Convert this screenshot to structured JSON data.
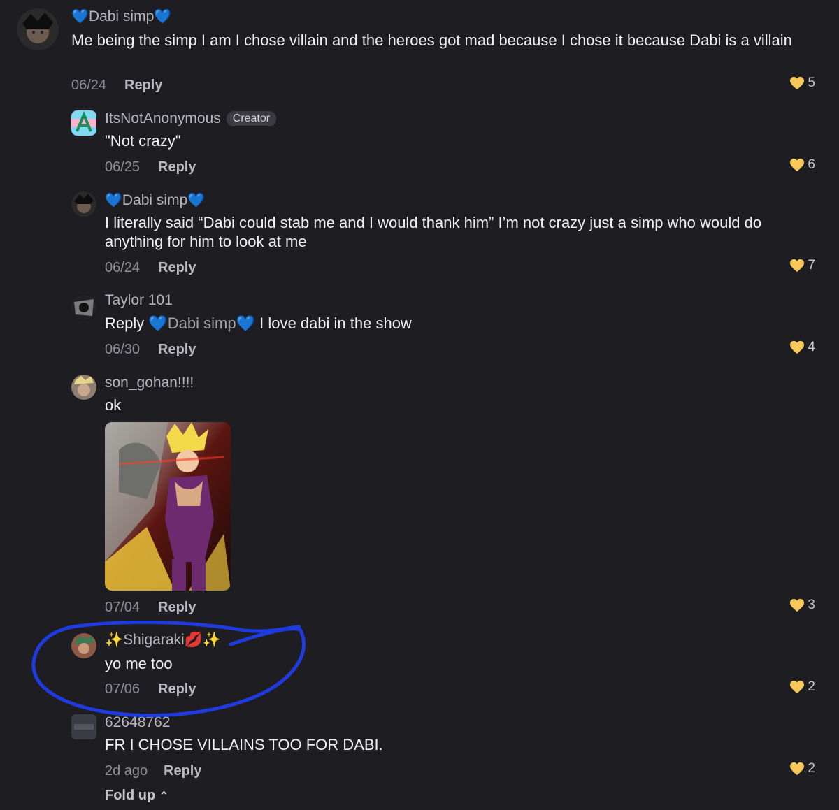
{
  "comments": [
    {
      "username": "Dabi simp",
      "text": "Me being the simp I am I chose villain and the heroes got mad because I chose it because Dabi is a villain",
      "date": "06/24",
      "reply_label": "Reply",
      "likes": "5"
    },
    {
      "username": "ItsNotAnonymous",
      "badge": "Creator",
      "text": "\"Not crazy\"",
      "date": "06/25",
      "reply_label": "Reply",
      "likes": "6"
    },
    {
      "username": "Dabi simp",
      "text": "I literally said “Dabi could stab me and I would thank him” I’m not crazy just a simp who would do anything for him to look at me",
      "date": "06/24",
      "reply_label": "Reply",
      "likes": "7"
    },
    {
      "username": "Taylor 101",
      "reply_prefix": "Reply",
      "mention": "Dabi simp",
      "text": "I love dabi in the show",
      "date": "06/30",
      "reply_label": "Reply",
      "likes": "4"
    },
    {
      "username": "son_gohan!!!!",
      "text": "ok",
      "date": "07/04",
      "reply_label": "Reply",
      "likes": "3"
    },
    {
      "username": "Shigaraki",
      "text": "yo me too",
      "date": "07/06",
      "reply_label": "Reply",
      "likes": "2"
    },
    {
      "username": "62648762",
      "text": "FR I CHOSE VILLAINS TOO FOR DABI.",
      "date": "2d ago",
      "reply_label": "Reply",
      "likes": "2"
    }
  ],
  "fold_label": "Fold up",
  "colors": {
    "background": "#1d1d22",
    "like_heart": "#f6c95a",
    "blue_heart": "#2f8cf0",
    "annotation_circle": "#1f3be0"
  },
  "icons": {
    "like": "heart-icon",
    "decor": "sparkle-icon",
    "fold": "chevron-up-icon"
  }
}
